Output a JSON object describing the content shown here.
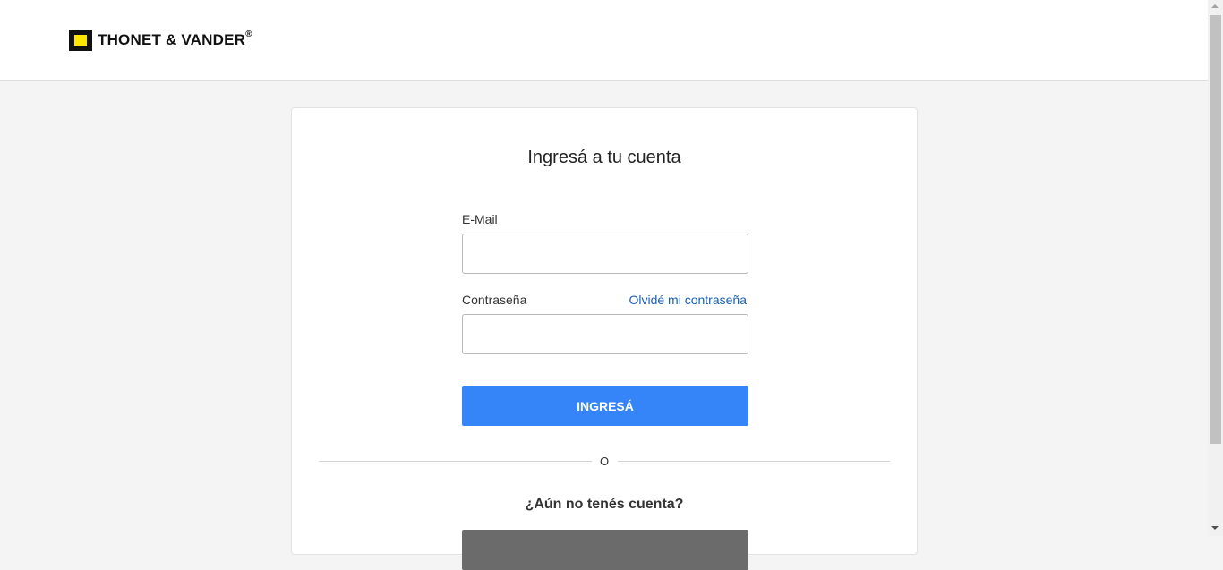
{
  "brand": {
    "name": "THONET & VANDER",
    "registered_mark": "®",
    "accent_color": "#ffe600"
  },
  "login": {
    "title": "Ingresá a tu cuenta",
    "email_label": "E-Mail",
    "email_value": "",
    "password_label": "Contraseña",
    "password_value": "",
    "forgot_password_link": "Olvidé mi contraseña",
    "submit_label": "INGRESÁ",
    "submit_color": "#3584f8",
    "divider_text": "O",
    "no_account_text": "¿Aún no tenés cuenta?",
    "register_label": ""
  }
}
